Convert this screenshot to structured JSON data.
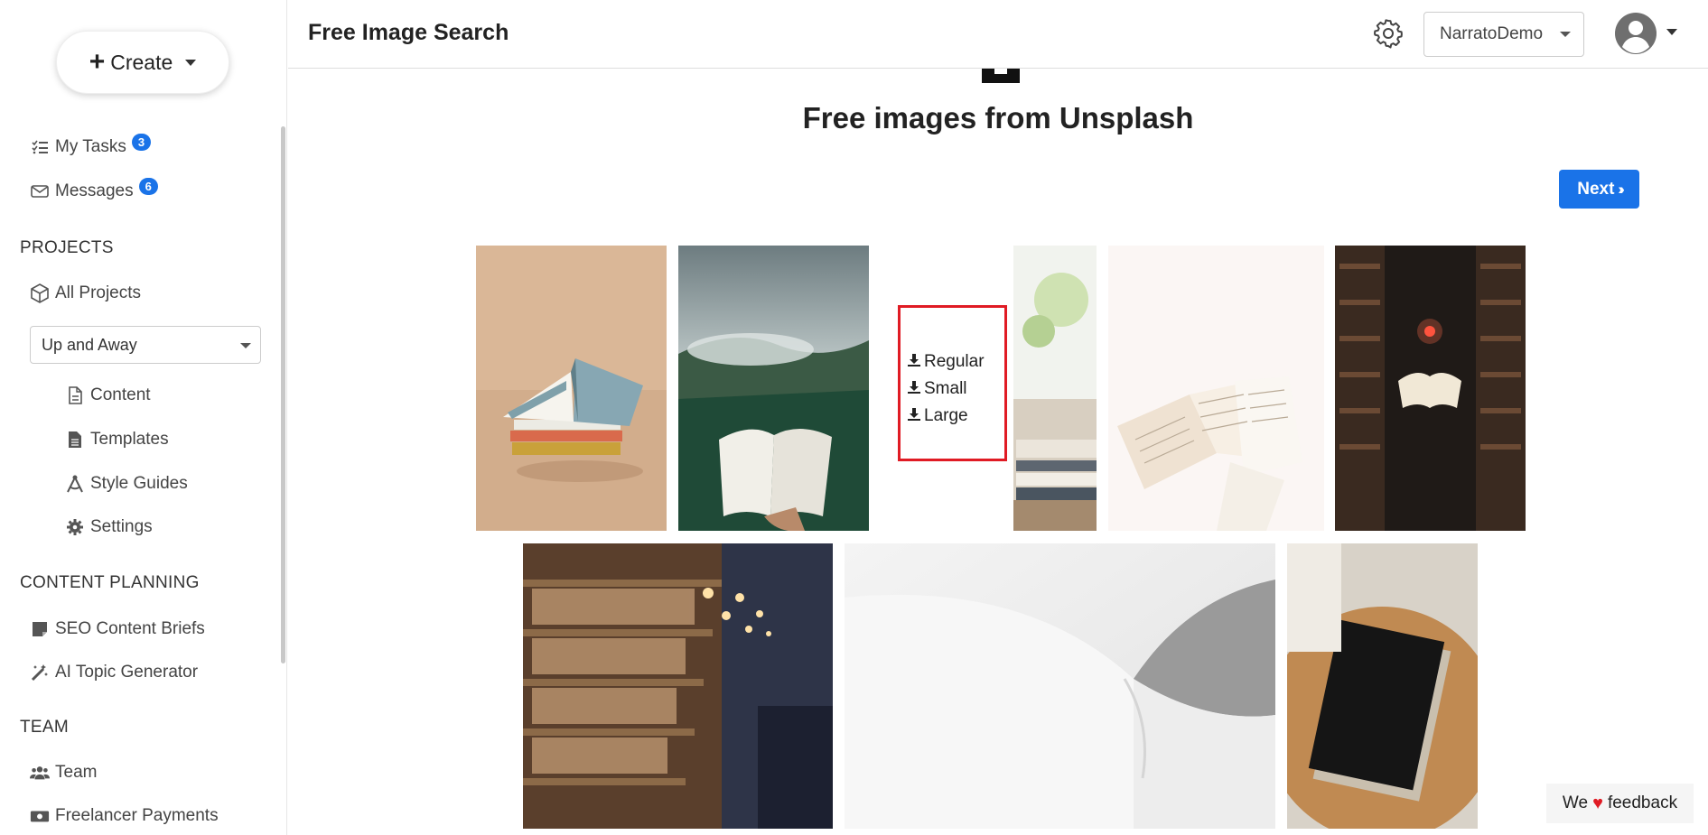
{
  "sidebar": {
    "create_label": "Create",
    "my_tasks": {
      "label": "My Tasks",
      "count": "3"
    },
    "messages": {
      "label": "Messages",
      "count": "6"
    },
    "projects_title": "PROJECTS",
    "all_projects": "All Projects",
    "project_selected": "Up and Away",
    "project_items": [
      "Content",
      "Templates",
      "Style Guides",
      "Settings"
    ],
    "content_planning_title": "CONTENT PLANNING",
    "planning_items": [
      "SEO Content Briefs",
      "AI Topic Generator"
    ],
    "team_title": "TEAM",
    "team_items": [
      "Team",
      "Freelancer Payments"
    ]
  },
  "header": {
    "title": "Free Image Search",
    "account": "NarratoDemo"
  },
  "main": {
    "heading": "Free images from Unsplash",
    "next_label": "Next",
    "download_options": [
      "Regular",
      "Small",
      "Large"
    ]
  },
  "feedback": {
    "prefix": "We",
    "suffix": "feedback"
  },
  "colors": {
    "accent": "#1a73e8",
    "highlight": "#e01b24"
  },
  "icons": [
    "plus-icon",
    "tasks-icon",
    "envelope-icon",
    "cube-icon",
    "file-icon",
    "file-lines-icon",
    "compass-drafting-icon",
    "gear-icon",
    "note-icon",
    "magic-wand-icon",
    "users-icon",
    "money-icon",
    "user-circle-icon",
    "download-icon",
    "heart-icon",
    "angles-right-icon"
  ]
}
